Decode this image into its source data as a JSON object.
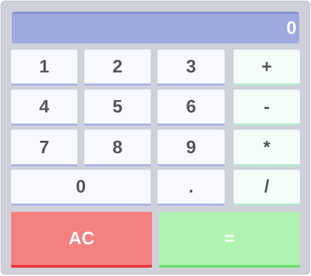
{
  "display": {
    "value": "0"
  },
  "keys": {
    "k1": "1",
    "k2": "2",
    "k3": "3",
    "k4": "4",
    "k5": "5",
    "k6": "6",
    "k7": "7",
    "k8": "8",
    "k9": "9",
    "k0": "0",
    "decimal": ".",
    "add": "+",
    "subtract": "-",
    "multiply": "*",
    "divide": "/",
    "clear": "AC",
    "equals": "="
  },
  "colors": {
    "frame": "#cfd1da",
    "display_bg": "#9eaade",
    "number_key_bg": "#f8f9fe",
    "operator_key_bg": "#f3fcf7",
    "clear_bg": "#f58080",
    "equals_bg": "#b0f3b0"
  }
}
